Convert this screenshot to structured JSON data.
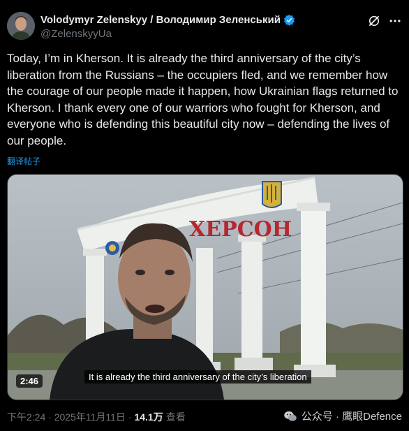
{
  "post": {
    "author_name": "Volodymyr Zelenskyy / Володимир Зеленський",
    "handle": "@ZelenskyyUa",
    "text": "Today, I’m in Kherson. It is already the third anniversary of the city’s liberation from the Russians – the occupiers fled, and we remember how the courage of our people made it happen, how Ukrainian flags returned to Kherson. I thank every one of our warriors who fought for Kherson, and everyone who is defending this beautiful city now – defending the lives of our people.",
    "translate_label": "翻译帖子",
    "timestamp": "下午2:24 · 2025年11月11日 ·",
    "views_count": "14.1万",
    "views_label": "查看"
  },
  "media": {
    "subtitle": "It is already the third anniversary of the city’s liberation",
    "duration": "2:46",
    "sign_text": "ХЕРСОН"
  },
  "watermark": {
    "text": "公众号 · 鹰眼Defence"
  },
  "icons": {
    "verified": "verified-badge-icon",
    "grok": "grok-icon",
    "more": "more-icon",
    "wechat": "wechat-icon"
  },
  "colors": {
    "accent": "#1d9bf0",
    "muted": "#71767b",
    "text": "#e7e9ea"
  }
}
